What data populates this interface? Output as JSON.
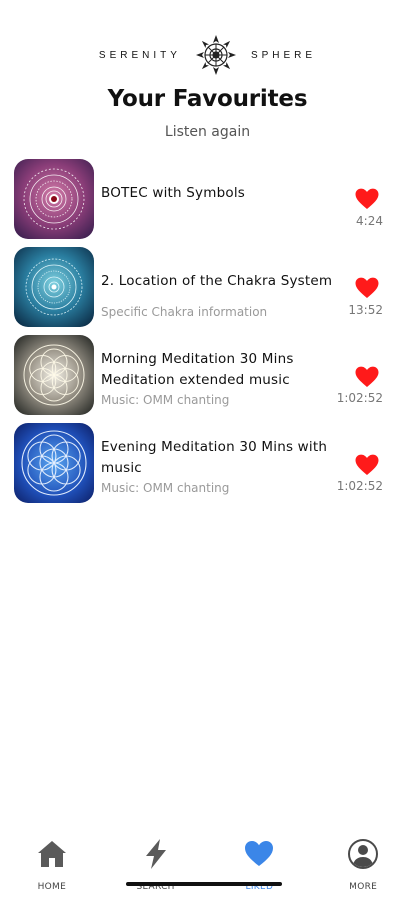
{
  "header": {
    "brand_left": "SERENITY",
    "brand_right": "SPHERE",
    "logo_icon": "mandala-logo-icon",
    "title": "Your Favourites",
    "subtitle": "Listen again"
  },
  "favourites": [
    {
      "title": "BOTEC with Symbols",
      "subtitle": "",
      "duration": "4:24",
      "thumb_icon": "pink-mandala-thumbnail"
    },
    {
      "title": "2. Location of the Chakra System",
      "subtitle": "Specific Chakra information",
      "duration": "13:52",
      "thumb_icon": "teal-mandala-thumbnail"
    },
    {
      "title": "Morning Meditation 30 Mins Meditation extended music",
      "subtitle": "Music: OMM chanting",
      "duration": "1:02:52",
      "thumb_icon": "flower-of-life-thumbnail"
    },
    {
      "title": "Evening Meditation 30 Mins with music",
      "subtitle": "Music: OMM chanting",
      "duration": "1:02:52",
      "thumb_icon": "blue-flower-of-life-thumbnail"
    }
  ],
  "nav": {
    "items": [
      {
        "label": "HOME",
        "icon": "home-icon"
      },
      {
        "label": "SEARCH",
        "icon": "lightning-icon"
      },
      {
        "label": "LIKED",
        "icon": "heart-icon"
      },
      {
        "label": "MORE",
        "icon": "profile-icon"
      }
    ],
    "active": "LIKED"
  },
  "colors": {
    "heart": "#ff1a1a",
    "accent": "#3b86e8",
    "subtitle": "#9a9a9a"
  }
}
